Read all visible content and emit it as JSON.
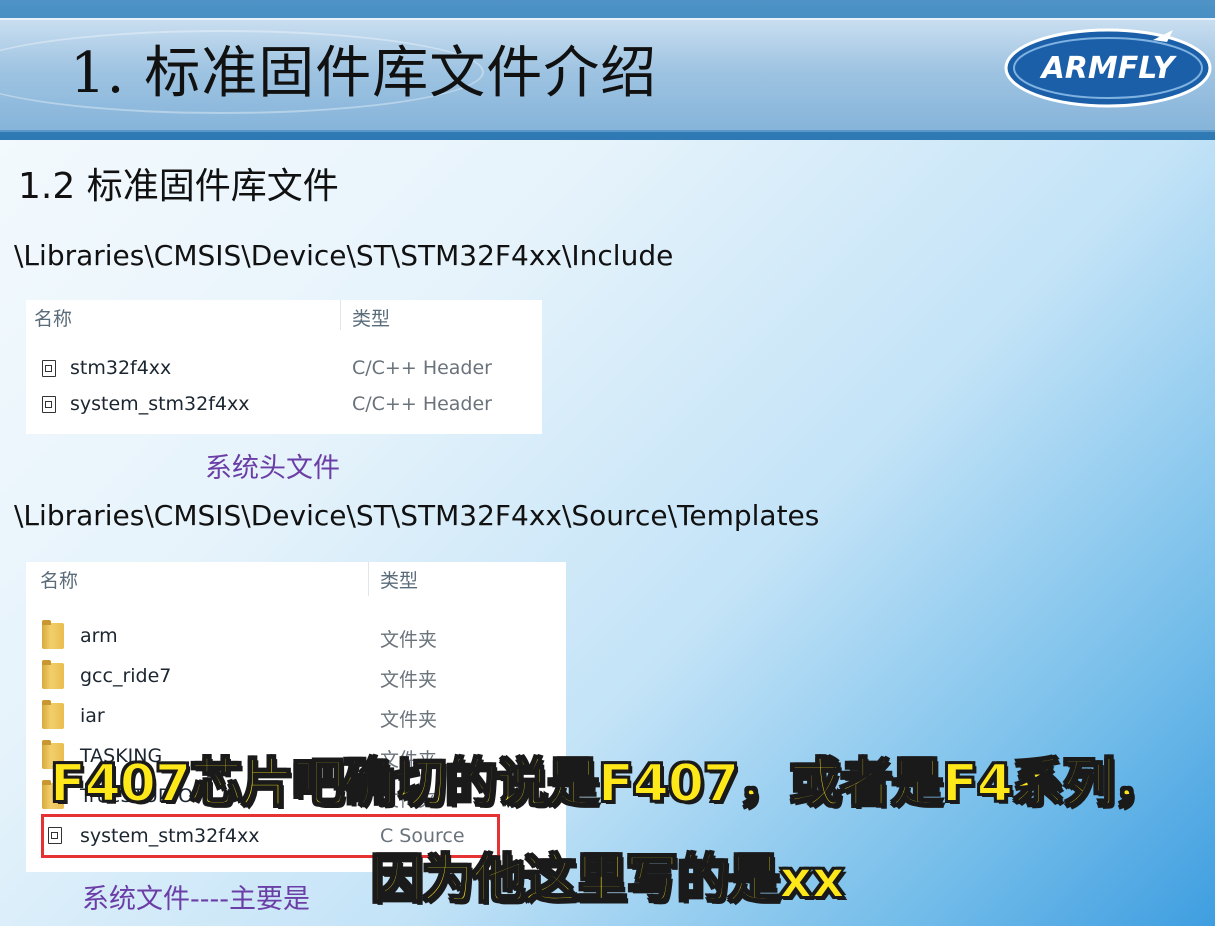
{
  "slide": {
    "title": "1. 标准固件库文件介绍",
    "logo_text": "ARMFLY",
    "section_title": "1.2 标准固件库文件"
  },
  "include_block": {
    "path": "\\Libraries\\CMSIS\\Device\\ST\\STM32F4xx\\Include",
    "column_name": "名称",
    "column_type": "类型",
    "files": [
      {
        "name": "stm32f4xx",
        "type": "C/C++ Header",
        "icon": "header-file-icon"
      },
      {
        "name": "system_stm32f4xx",
        "type": "C/C++ Header",
        "icon": "header-file-icon"
      }
    ],
    "caption": "系统头文件"
  },
  "templates_block": {
    "path": "\\Libraries\\CMSIS\\Device\\ST\\STM32F4xx\\Source\\Templates",
    "column_name": "名称",
    "column_type": "类型",
    "files": [
      {
        "name": "arm",
        "type": "文件夹",
        "icon": "folder-icon"
      },
      {
        "name": "gcc_ride7",
        "type": "文件夹",
        "icon": "folder-icon"
      },
      {
        "name": "iar",
        "type": "文件夹",
        "icon": "folder-icon"
      },
      {
        "name": "TASKING",
        "type": "文件夹",
        "icon": "folder-icon"
      },
      {
        "name": "TrueSTUDIO",
        "type": "文件夹",
        "icon": "folder-icon"
      },
      {
        "name": "system_stm32f4xx",
        "type": "C Source",
        "icon": "c-source-file-icon"
      }
    ],
    "caption": "系统文件----主要是",
    "highlight_color": "#e53232"
  },
  "subtitles": {
    "line1": "F407芯片吧确切的说是F407，或者是F4系列，",
    "line2": "因为他这里写的是xx",
    "color": "#ffe81a"
  }
}
